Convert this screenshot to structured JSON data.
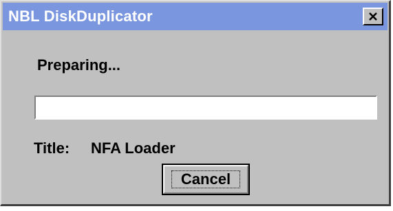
{
  "window": {
    "title": "NBL DiskDuplicator",
    "titlebar_color": "#7a96df",
    "background_color": "#c0c0c0"
  },
  "status": {
    "text": "Preparing...",
    "progress": 0
  },
  "info": {
    "title_label": "Title:",
    "title_value": "NFA Loader"
  },
  "buttons": {
    "cancel_label": "Cancel",
    "close_icon": "close-icon"
  }
}
